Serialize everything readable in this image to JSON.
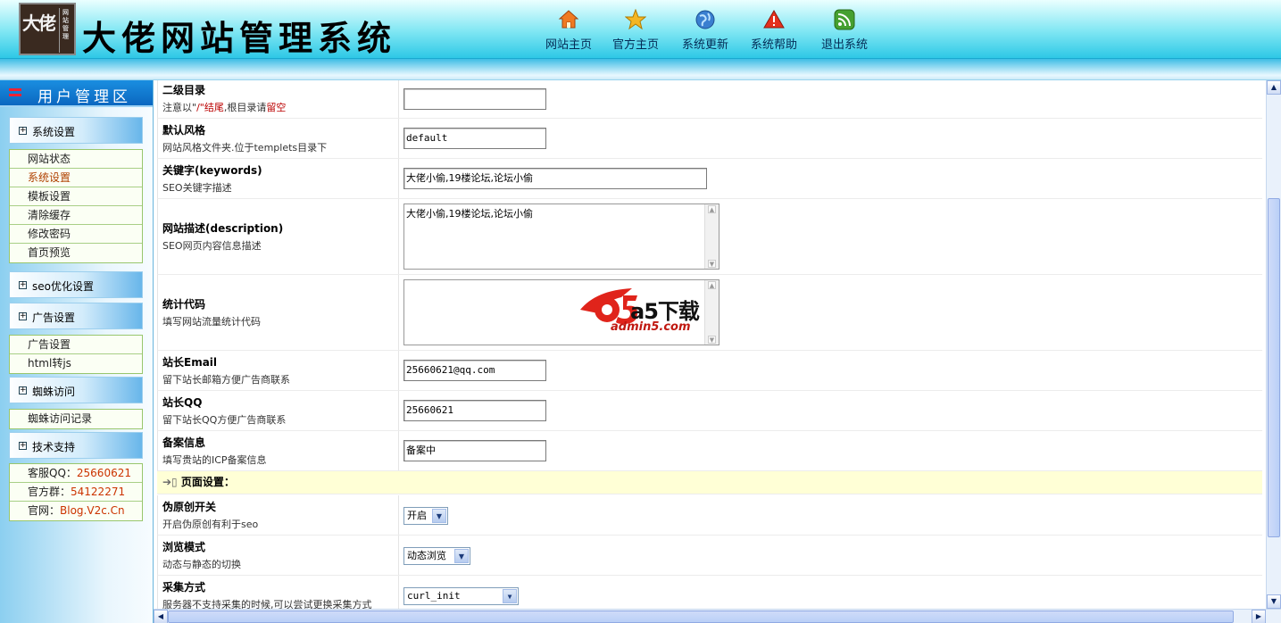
{
  "app": {
    "title": "大佬网站管理系统",
    "logo_text": "大佬",
    "logo_seal": "网站管理"
  },
  "nav": [
    {
      "label": "网站主页",
      "icon": "home-icon",
      "color": "#f07a22"
    },
    {
      "label": "官方主页",
      "icon": "star-icon",
      "color": "#f4b623"
    },
    {
      "label": "系统更新",
      "icon": "globe-icon",
      "color": "#3a7fd0"
    },
    {
      "label": "系统帮助",
      "icon": "warning-icon",
      "color": "#e4301c"
    },
    {
      "label": "退出系统",
      "icon": "rss-icon",
      "color": "#45a030"
    }
  ],
  "sidebar": {
    "title": "用户管理区",
    "sections": [
      {
        "label": "系统设置",
        "items": [
          "网站状态",
          "系统设置",
          "模板设置",
          "清除缓存",
          "修改密码",
          "首页预览"
        ],
        "active": 1
      },
      {
        "label": "seo优化设置",
        "items": []
      },
      {
        "label": "广告设置",
        "items": [
          "广告设置",
          "html转js"
        ]
      },
      {
        "label": "蜘蛛访问",
        "items": [
          "蜘蛛访问记录"
        ]
      },
      {
        "label": "技术支持",
        "items": []
      }
    ],
    "support": [
      {
        "label": "客服QQ：",
        "value": "25660621"
      },
      {
        "label": "官方群：",
        "value": "54122271"
      },
      {
        "label": "官网：",
        "value": "Blog.V2c.Cn"
      }
    ]
  },
  "form": {
    "subdir": {
      "label": "二级目录",
      "hint_a": "注意以\"",
      "hint_b": "/\"结尾",
      "hint_c": ",根目录请",
      "hint_d": "留空",
      "value": ""
    },
    "style": {
      "label": "默认风格",
      "hint": "网站风格文件夹.位于templets目录下",
      "value": "default"
    },
    "keywords": {
      "label": "关键字(keywords)",
      "hint": "SEO关键字描述",
      "value": "大佬小偷,19楼论坛,论坛小偷"
    },
    "description": {
      "label": "网站描述(description)",
      "hint": "SEO网页内容信息描述",
      "value": "大佬小偷,19楼论坛,论坛小偷"
    },
    "stats": {
      "label": "统计代码",
      "hint": "填写网站流量统计代码",
      "watermark_main": "a5下载",
      "watermark_sub": "admin5.com"
    },
    "email": {
      "label": "站长Email",
      "hint": "留下站长邮箱方便广告商联系",
      "value": "25660621@qq.com"
    },
    "qq": {
      "label": "站长QQ",
      "hint": "留下站长QQ方便广告商联系",
      "value": "25660621"
    },
    "icp": {
      "label": "备案信息",
      "hint": "填写贵站的ICP备案信息",
      "value": "备案中"
    },
    "page_section": "页面设置：",
    "pseudo": {
      "label": "伪原创开关",
      "hint": "开启伪原创有利于seo",
      "value": "开启"
    },
    "browse": {
      "label": "浏览模式",
      "hint": "动态与静态的切换",
      "value": "动态浏览"
    },
    "collect": {
      "label": "采集方式",
      "hint": "服务器不支持采集的时候,可以尝试更换采集方式",
      "value": "curl_init"
    }
  }
}
